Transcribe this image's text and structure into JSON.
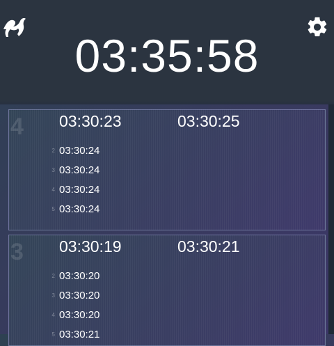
{
  "header": {
    "clock": "03:35:58",
    "logo_icon": "deer-antler-icon",
    "settings_icon": "gear-icon"
  },
  "panels": [
    {
      "number": "4",
      "start": "03:30:23",
      "end": "03:30:25",
      "rows": [
        {
          "index": "2",
          "time": "03:30:24"
        },
        {
          "index": "3",
          "time": "03:30:24"
        },
        {
          "index": "4",
          "time": "03:30:24"
        },
        {
          "index": "5",
          "time": "03:30:24"
        }
      ]
    },
    {
      "number": "3",
      "start": "03:30:19",
      "end": "03:30:21",
      "rows": [
        {
          "index": "2",
          "time": "03:30:20"
        },
        {
          "index": "3",
          "time": "03:30:20"
        },
        {
          "index": "4",
          "time": "03:30:20"
        },
        {
          "index": "5",
          "time": "03:30:21"
        }
      ]
    }
  ]
}
